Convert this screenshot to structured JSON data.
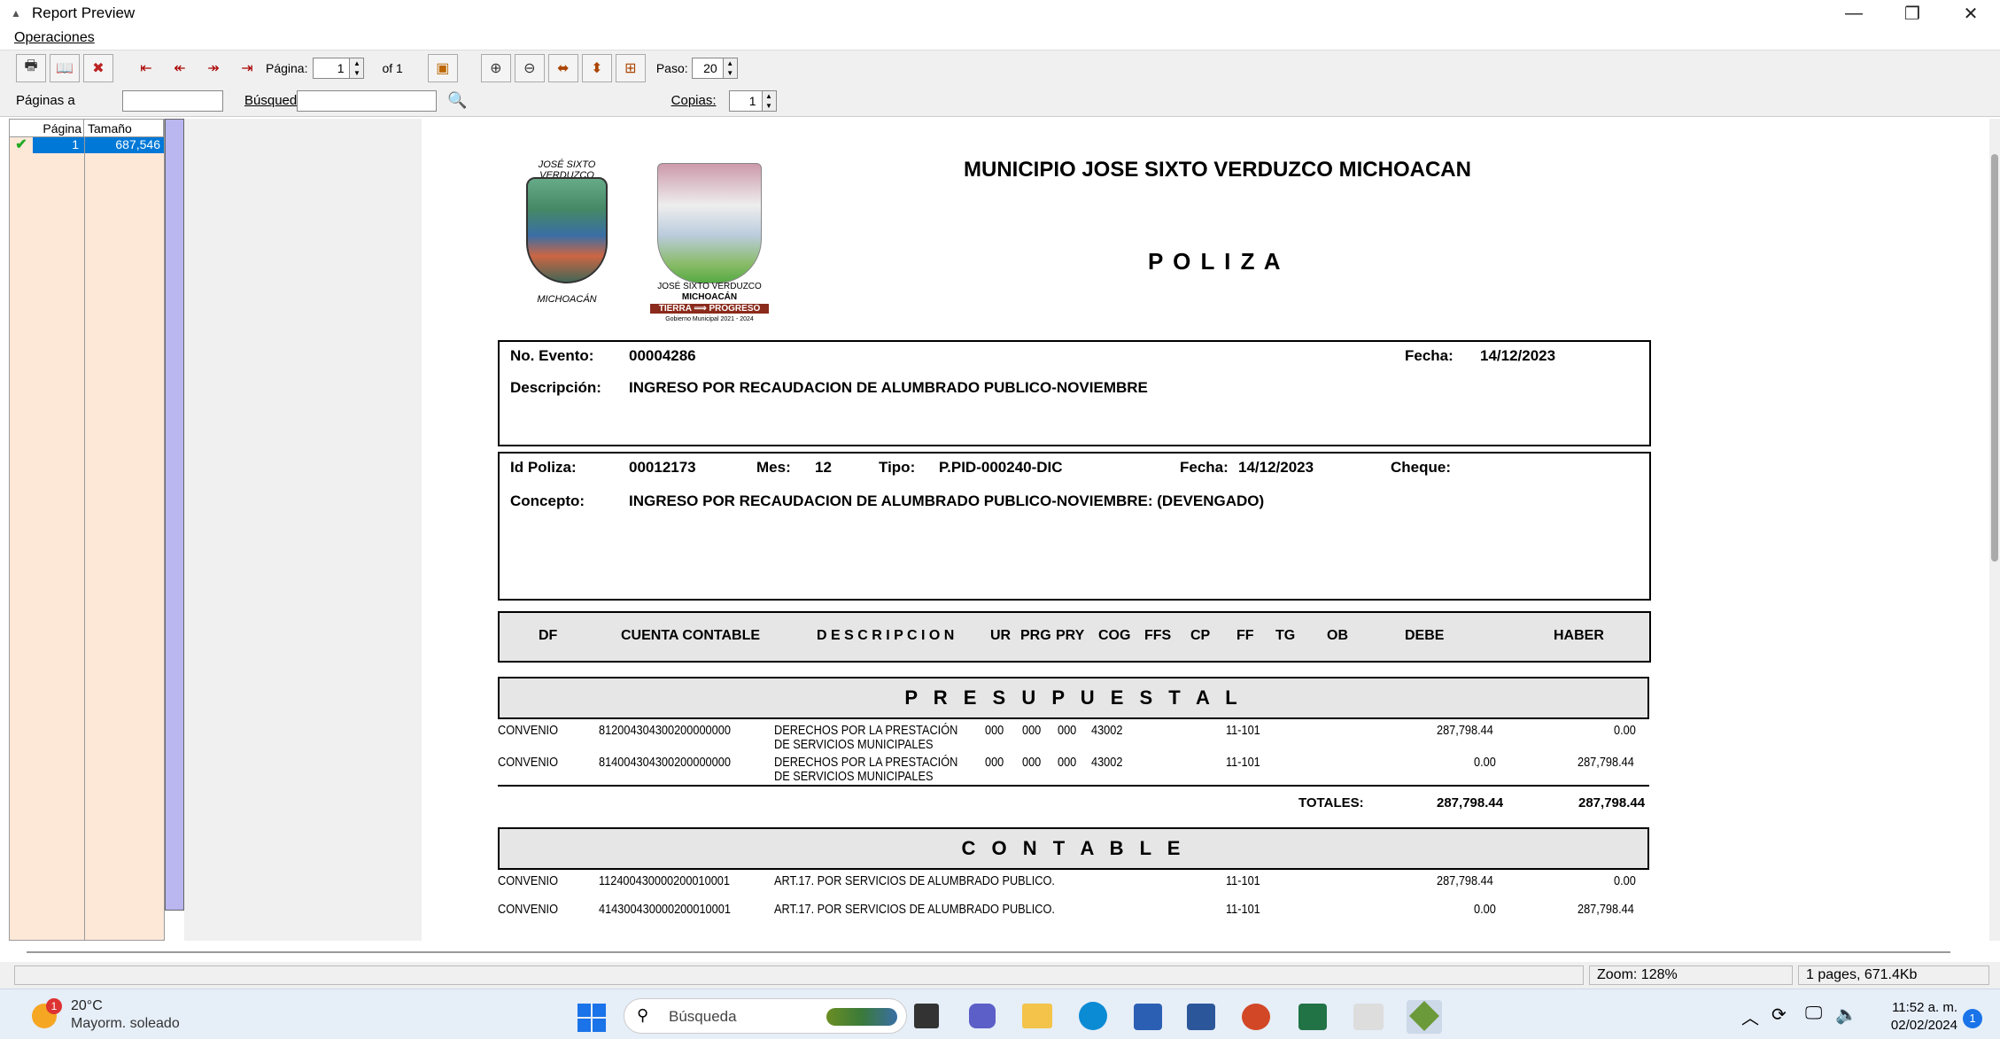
{
  "window": {
    "title": "Report Preview",
    "minimize": "—",
    "restore": "❐",
    "close": "✕"
  },
  "menu": {
    "operaciones": "Operaciones"
  },
  "toolbar": {
    "pagina_label": "Página:",
    "pagina_value": "1",
    "of_label": "of 1",
    "paso_label": "Paso:",
    "paso_value": "20"
  },
  "toolbar2": {
    "paginas_label": "Páginas a",
    "busqueda_label": "Búsqued",
    "copias_label": "Copias:",
    "copias_value": "1"
  },
  "page_list": {
    "col_pagina": "Página",
    "col_tamano": "Tamaño",
    "rows": [
      {
        "pagina": "1",
        "tamano": "687,546"
      }
    ]
  },
  "report": {
    "municipio": "MUNICIPIO JOSE SIXTO VERDUZCO MICHOACAN",
    "title": "P O L I Z A",
    "logo1_top": "JOSÉ SIXTO VERDUZCO",
    "logo1_bottom": "MICHOACÁN",
    "logo2_line1": "JOSÉ SIXTO VERDUZCO",
    "logo2_line2": "MICHOACÁN",
    "logo2_line3": "TIERRA ⟹ PROGRESO",
    "logo2_line4": "Gobierno Municipal 2021 - 2024",
    "no_evento_label": "No. Evento:",
    "no_evento": "00004286",
    "fecha_label": "Fecha:",
    "fecha": "14/12/2023",
    "descripcion_label": "Descripción:",
    "descripcion": "INGRESO POR RECAUDACION DE ALUMBRADO PUBLICO-NOVIEMBRE",
    "id_poliza_label": "Id Poliza:",
    "id_poliza": "00012173",
    "mes_label": "Mes:",
    "mes": "12",
    "tipo_label": "Tipo:",
    "tipo": "P.PID-000240-DIC",
    "fecha2_label": "Fecha:",
    "fecha2": "14/12/2023",
    "cheque_label": "Cheque:",
    "concepto_label": "Concepto:",
    "concepto": "INGRESO POR RECAUDACION DE ALUMBRADO PUBLICO-NOVIEMBRE: (DEVENGADO)",
    "columns": [
      "DF",
      "CUENTA CONTABLE",
      "D E S C R I P C I O N",
      "UR",
      "PRG",
      "PRY",
      "COG",
      "FFS",
      "CP",
      "FF",
      "TG",
      "OB",
      "DEBE",
      "HABER"
    ],
    "presupuestal_title": "P R E S U P U E S T A L",
    "presupuestal_rows": [
      {
        "df": "CONVENIO",
        "cuenta": "812004304300200000000",
        "desc1": "DERECHOS POR LA PRESTACIÓN",
        "desc2": "DE SERVICIOS MUNICIPALES",
        "ur": "000",
        "prg": "000",
        "pry": "000",
        "cog": "43002",
        "ff": "11-101",
        "debe": "287,798.44",
        "haber": "0.00"
      },
      {
        "df": "CONVENIO",
        "cuenta": "814004304300200000000",
        "desc1": "DERECHOS POR LA PRESTACIÓN",
        "desc2": "DE SERVICIOS MUNICIPALES",
        "ur": "000",
        "prg": "000",
        "pry": "000",
        "cog": "43002",
        "ff": "11-101",
        "debe": "0.00",
        "haber": "287,798.44"
      }
    ],
    "totales_label": "TOTALES:",
    "totales_debe": "287,798.44",
    "totales_haber": "287,798.44",
    "contable_title": "C O N T A B L E",
    "contable_rows": [
      {
        "df": "CONVENIO",
        "cuenta": "112400430000200010001",
        "desc": "ART.17. POR SERVICIOS DE ALUMBRADO PUBLICO.",
        "ff": "11-101",
        "debe": "287,798.44",
        "haber": "0.00"
      },
      {
        "df": "CONVENIO",
        "cuenta": "414300430000200010001",
        "desc": "ART.17. POR SERVICIOS DE ALUMBRADO PUBLICO.",
        "ff": "11-101",
        "debe": "0.00",
        "haber": "287,798.44"
      }
    ]
  },
  "status": {
    "zoom": "Zoom: 128%",
    "pages": "1 pages, 671.4Kb"
  },
  "taskbar": {
    "weather_temp": "20°C",
    "weather_desc": "Mayorm. soleado",
    "weather_badge": "1",
    "search_placeholder": "Búsqueda",
    "time": "11:52 a. m.",
    "date": "02/02/2024",
    "notif_count": "1"
  },
  "colors": {
    "selection": "#0078d7",
    "panel_bg": "#fde8d8",
    "scroll_bar": "#b9b6f0"
  }
}
